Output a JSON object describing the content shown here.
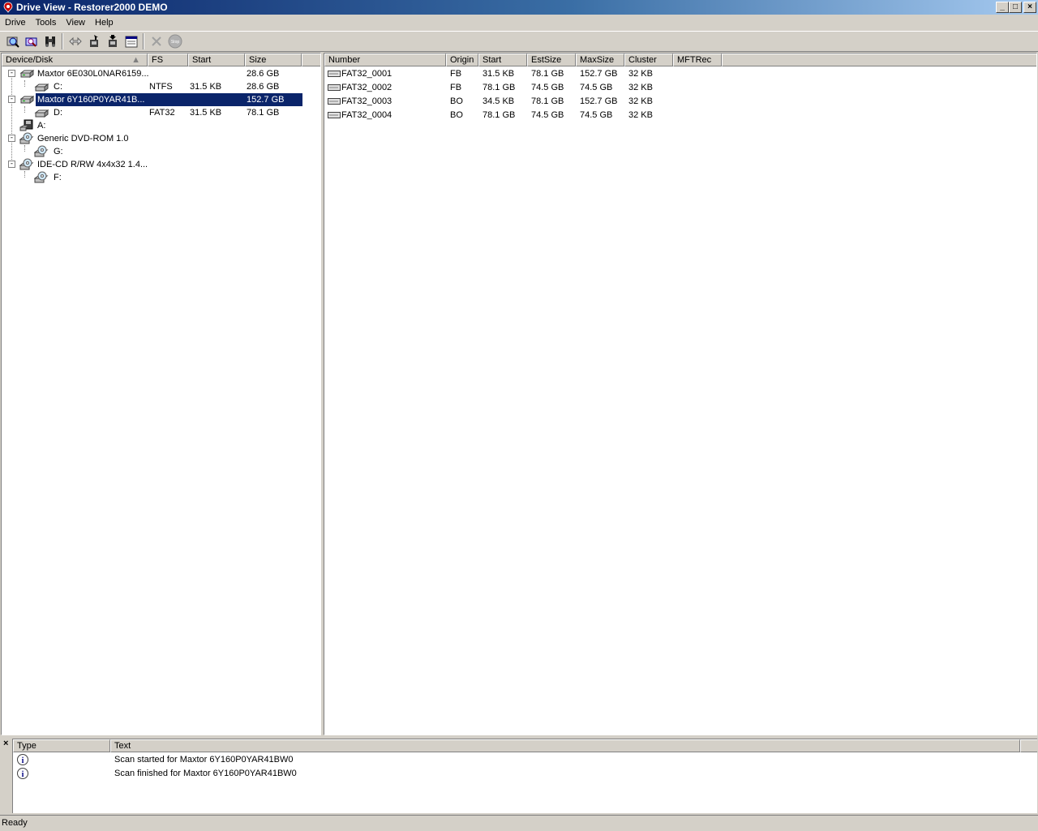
{
  "window": {
    "title": "Drive View - Restorer2000 DEMO",
    "btn_min": "_",
    "btn_max": "□",
    "btn_close": "×"
  },
  "menu": [
    "Drive",
    "Tools",
    "View",
    "Help"
  ],
  "toolbar": {
    "icons": [
      "scan-icon",
      "find-icon",
      "search-binoculars-icon",
      "compare-icon",
      "open-image-icon",
      "save-image-icon",
      "properties-icon",
      "cancel-icon",
      "stop-icon"
    ],
    "stop_label": "Stop"
  },
  "drives": {
    "columns": [
      "Device/Disk",
      "FS",
      "Start",
      "Size"
    ],
    "rows": [
      {
        "name": "Maxtor 6E030L0NAR6159...",
        "fs": "",
        "start": "",
        "size": "28.6 GB",
        "level": 0,
        "icon": "hard-disk-icon"
      },
      {
        "name": "C:",
        "fs": "NTFS",
        "start": "31.5 KB",
        "size": "28.6 GB",
        "level": 1,
        "icon": "partition-icon"
      },
      {
        "name": "Maxtor 6Y160P0YAR41B...",
        "fs": "",
        "start": "",
        "size": "152.7 GB",
        "level": 0,
        "icon": "hard-disk-icon",
        "selected": true
      },
      {
        "name": "D:",
        "fs": "FAT32",
        "start": "31.5 KB",
        "size": "78.1 GB",
        "level": 1,
        "icon": "partition-icon"
      },
      {
        "name": "A:",
        "fs": "",
        "start": "",
        "size": "",
        "level": 0,
        "icon": "floppy-drive-icon"
      },
      {
        "name": "Generic DVD-ROM 1.0",
        "fs": "",
        "start": "",
        "size": "",
        "level": 0,
        "icon": "cd-drive-icon"
      },
      {
        "name": "G:",
        "fs": "",
        "start": "",
        "size": "",
        "level": 1,
        "icon": "cd-disc-icon"
      },
      {
        "name": "IDE-CD R/RW 4x4x32 1.4...",
        "fs": "",
        "start": "",
        "size": "",
        "level": 0,
        "icon": "cd-drive-icon"
      },
      {
        "name": "F:",
        "fs": "",
        "start": "",
        "size": "",
        "level": 1,
        "icon": "cd-disc-icon"
      }
    ]
  },
  "partitions": {
    "columns": [
      "Number",
      "Origin",
      "Start",
      "EstSize",
      "MaxSize",
      "Cluster",
      "MFTRec"
    ],
    "rows": [
      {
        "number": "FAT32_0001",
        "origin": "FB",
        "start": "31.5 KB",
        "estsize": "78.1 GB",
        "maxsize": "152.7 GB",
        "cluster": "32 KB",
        "mftrec": ""
      },
      {
        "number": "FAT32_0002",
        "origin": "FB",
        "start": "78.1 GB",
        "estsize": "74.5 GB",
        "maxsize": "74.5 GB",
        "cluster": "32 KB",
        "mftrec": ""
      },
      {
        "number": "FAT32_0003",
        "origin": "BO",
        "start": "34.5 KB",
        "estsize": "78.1 GB",
        "maxsize": "152.7 GB",
        "cluster": "32 KB",
        "mftrec": ""
      },
      {
        "number": "FAT32_0004",
        "origin": "BO",
        "start": "78.1 GB",
        "estsize": "74.5 GB",
        "maxsize": "74.5 GB",
        "cluster": "32 KB",
        "mftrec": ""
      }
    ]
  },
  "log": {
    "close": "×",
    "columns": [
      "Type",
      "Text"
    ],
    "rows": [
      {
        "type_icon": "info-icon",
        "text": "Scan started for Maxtor 6Y160P0YAR41BW0"
      },
      {
        "type_icon": "info-icon",
        "text": "Scan finished for Maxtor 6Y160P0YAR41BW0"
      }
    ]
  },
  "status": "Ready"
}
